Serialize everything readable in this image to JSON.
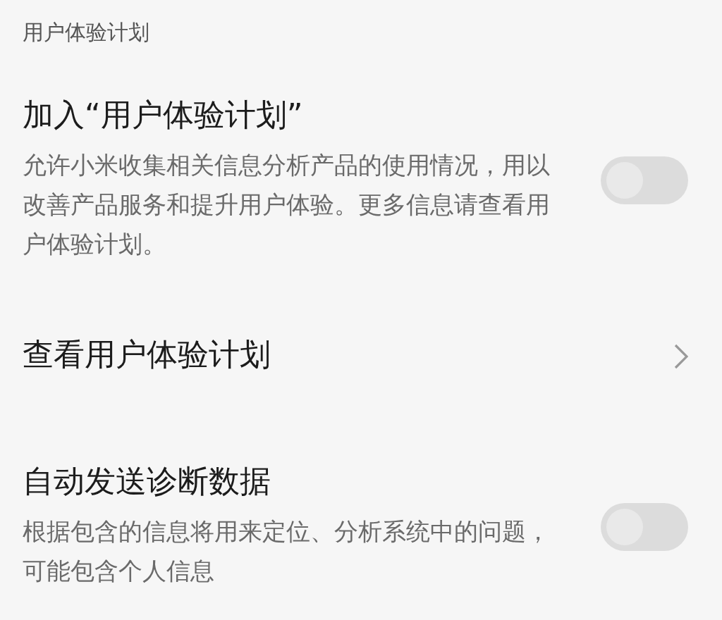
{
  "section_header": "用户体验计划",
  "items": [
    {
      "kind": "toggle",
      "title": "加入“用户体验计划”",
      "description": "允许小米收集相关信息分析产品的使用情况，用以改善产品服务和提升用户体验。更多信息请查看用户体验计划。",
      "on": false
    },
    {
      "kind": "link",
      "title": "查看用户体验计划"
    },
    {
      "kind": "toggle",
      "title": "自动发送诊断数据",
      "description": "根据包含的信息将用来定位、分析系统中的问题，可能包含个人信息",
      "on": false
    }
  ]
}
